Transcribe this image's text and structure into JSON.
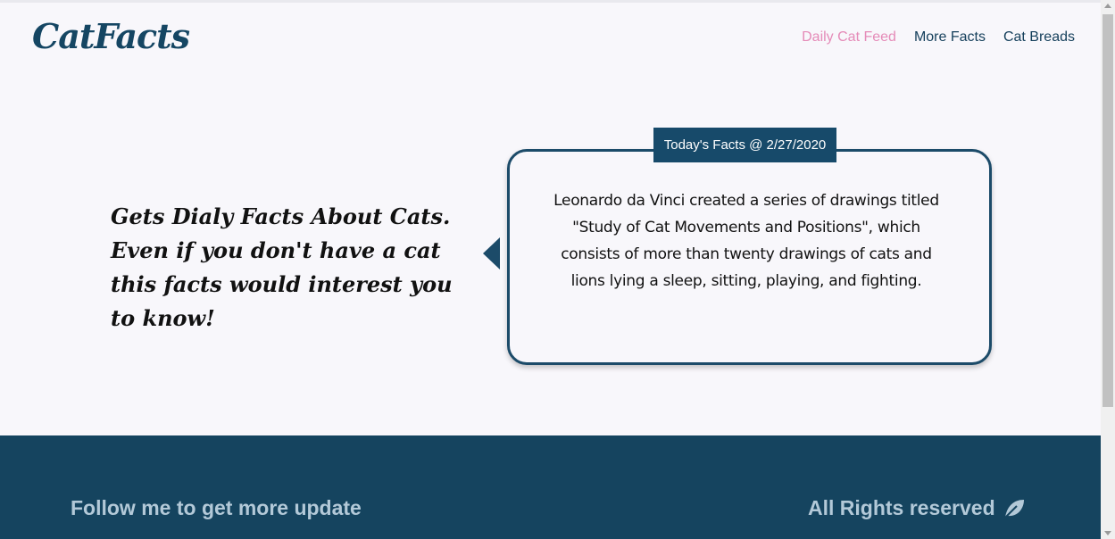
{
  "header": {
    "logo": "CatFacts",
    "nav": [
      {
        "label": "Daily Cat Feed",
        "active": true
      },
      {
        "label": "More Facts",
        "active": false
      },
      {
        "label": "Cat Breads",
        "active": false
      }
    ]
  },
  "hero": {
    "tagline": "Gets Dialy Facts About Cats. Even if you don't have a cat this facts would interest you to know!"
  },
  "fact": {
    "date_label": "Today's Facts @ 2/27/2020",
    "text": "Leonardo da Vinci created a series of drawings titled \"Study of Cat Movements and Positions\", which consists of more than twenty drawings of cats and lions lying a sleep, sitting, playing, and fighting."
  },
  "footer": {
    "left_text": "Follow me to get more update",
    "right_text": "All Rights reserved",
    "right_icon": "leaf-icon"
  },
  "colors": {
    "brand": "#154663",
    "accent_pink": "#e58bb8",
    "footer_bg": "#15445f",
    "footer_text": "#b3c9d8"
  }
}
